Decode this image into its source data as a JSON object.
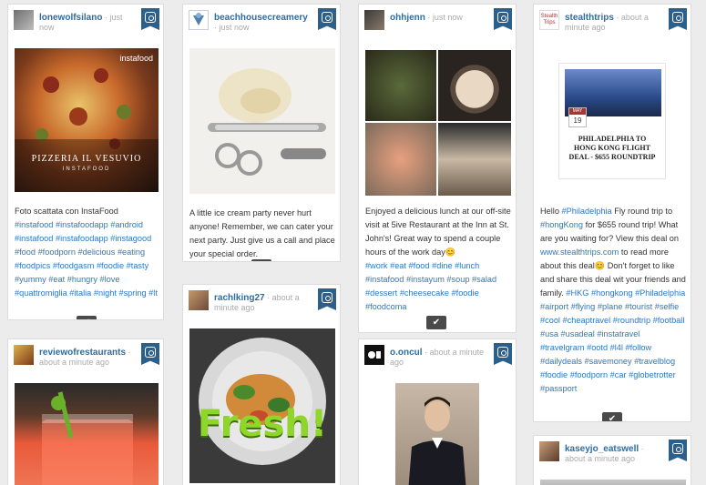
{
  "colors": {
    "accent": "#2a78c4",
    "username": "#2a6da8",
    "badge": "#2c5f8a",
    "button": "#4a4a4a",
    "background": "#ececec"
  },
  "icons": {
    "network": "instagram-icon",
    "approve": "checkmark-icon"
  },
  "posts": [
    {
      "username": "lonewolfsilano",
      "time": "just now",
      "image_overlay": {
        "title": "PIZZERIA IL VESUVIO",
        "subtitle": "INSTAFOOD",
        "brand": "instafood"
      },
      "caption": [
        "Foto scattata con InstaFood"
      ],
      "tags": [
        "#instafood",
        "#instafoodapp",
        "#android",
        "#instafood",
        "#instafoodapp",
        "#instagood",
        "#food",
        "#foodporn",
        "#delicious",
        "#eating",
        "#foodpics",
        "#foodgasm",
        "#foodie",
        "#tasty",
        "#yummy",
        "#eat",
        "#hungry",
        "#love",
        "#quattromiglia",
        "#italia",
        "#night",
        "#spring",
        "#lt"
      ]
    },
    {
      "username": "beachhousecreamery",
      "time": "just now",
      "caption": [
        "A little ice cream party never hurt anyone! Remember, we can cater your next party. Just give us a call and place your special order."
      ],
      "tags": []
    },
    {
      "username": "ohhjenn",
      "time": "just now",
      "caption": [
        "Enjoyed a delicious lunch at our off-site visit at 5ive Restaurant at the Inn at St. John's! Great way to spend a couple hours of the work day😊"
      ],
      "tags": [
        "#work",
        "#eat",
        "#food",
        "#dine",
        "#lunch",
        "#instafood",
        "#instayum",
        "#soup",
        "#salad",
        "#dessert",
        "#cheesecake",
        "#foodie",
        "#foodcoma"
      ]
    },
    {
      "username": "stealthtrips",
      "time": "about a minute ago",
      "avatar_text": "Stealth Trips",
      "image_overlay": {
        "headline": "PHILADELPHIA TO HONG KONG FLIGHT DEAL - $655 ROUNDTRIP",
        "month": "MAY",
        "day": "19"
      },
      "caption_parts": [
        {
          "t": "Hello "
        },
        {
          "t": "#Philadelphia",
          "tag": true
        },
        {
          "t": " Fly round trip to "
        },
        {
          "t": "#hongKong",
          "tag": true
        },
        {
          "t": " for $655 round trip! What are you waiting for? View this deal on "
        },
        {
          "t": "www.stealthtrips.com",
          "tag": true
        },
        {
          "t": " to read more about this deal😊 Don't forget to like and share this deal wit your friends and family. "
        }
      ],
      "tags": [
        "#HKG",
        "#hongkong",
        "#Philadelphia",
        "#airport",
        "#flying",
        "#plane",
        "#tourist",
        "#selfie",
        "#cool",
        "#cheaptravel",
        "#roundtrip",
        "#football",
        "#usa",
        "#usadeal",
        "#instatravel",
        "#travelgram",
        "#ootd",
        "#l4l",
        "#follow",
        "#dailydeals",
        "#savemoney",
        "#travelblog",
        "#foodie",
        "#foodporn",
        "#car",
        "#globetrotter",
        "#passport"
      ]
    },
    {
      "username": "rachlking27",
      "time": "about a minute ago",
      "image_overlay": {
        "title": "Fresh!"
      },
      "caption": [],
      "tags": []
    },
    {
      "username": "reviewofrestaurants",
      "time": "about a minute ago",
      "caption": [],
      "tags": []
    },
    {
      "username": "o.oncul",
      "time": "about a minute ago",
      "caption": [],
      "tags": []
    },
    {
      "username": "kaseyjo_eatswell",
      "time": "about a minute ago",
      "caption": [],
      "tags": []
    }
  ]
}
